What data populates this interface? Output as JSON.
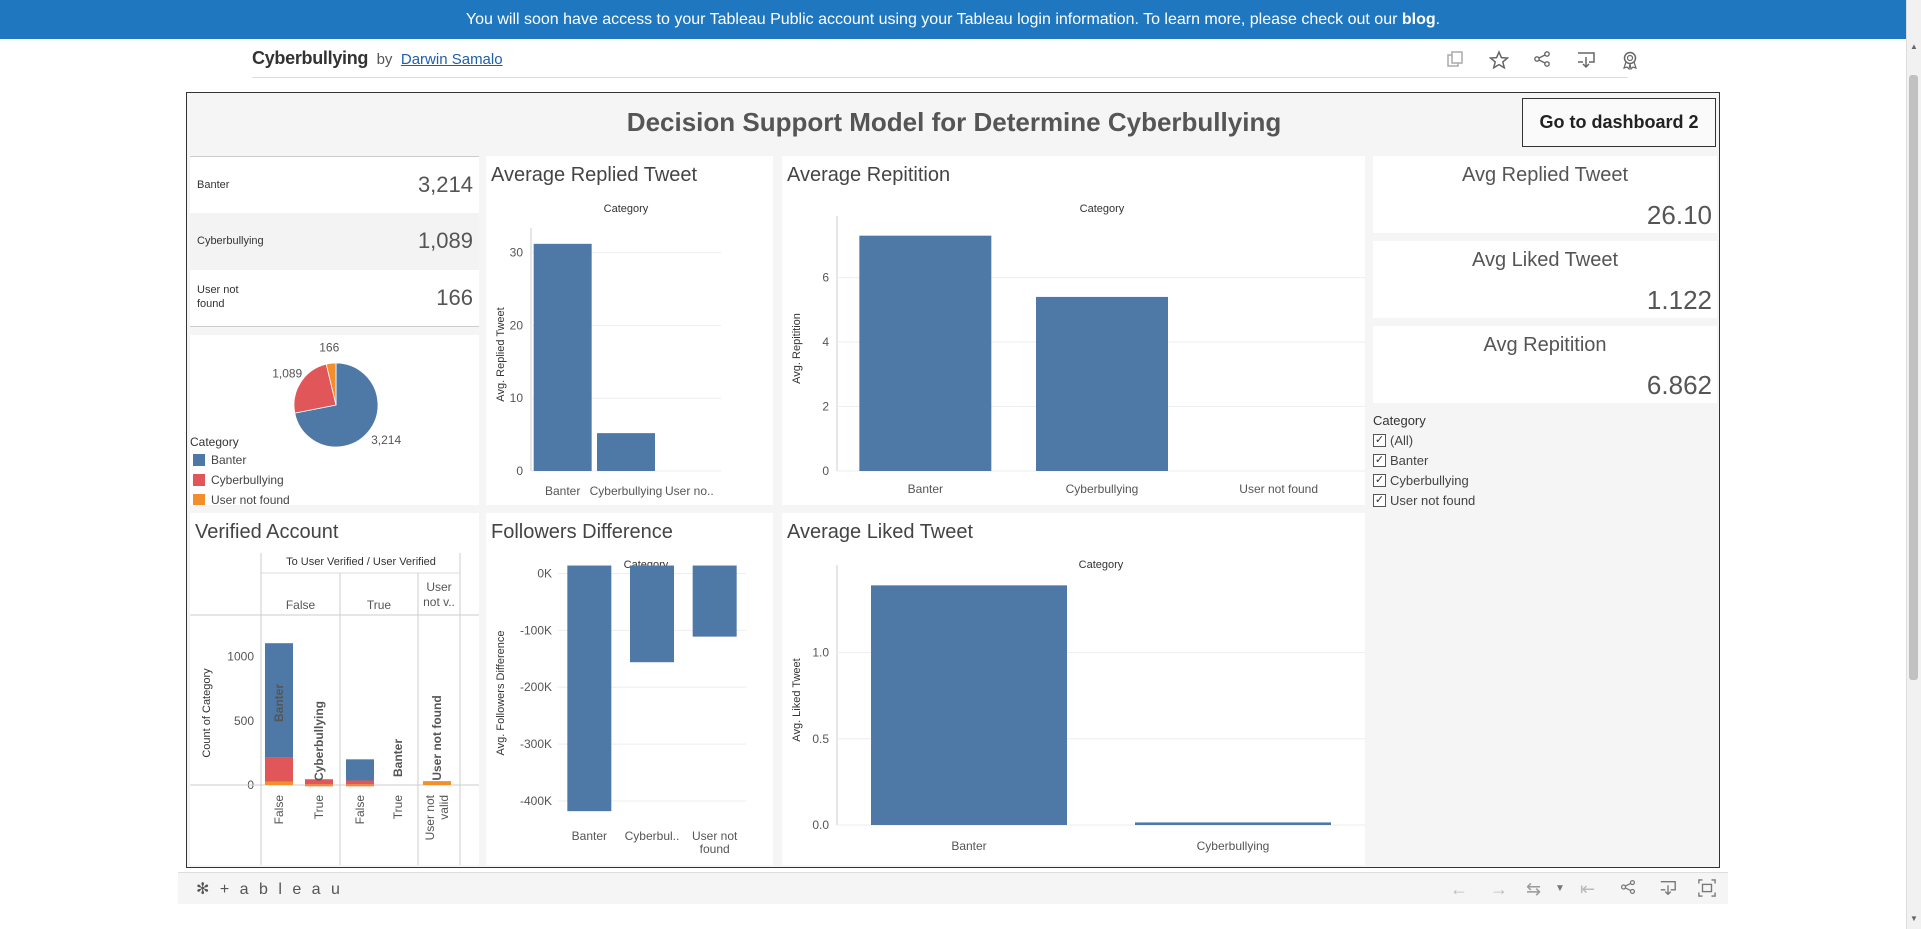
{
  "banner": {
    "text_before": "You will soon have access to your Tableau Public account using your Tableau login information. To learn more, please check out our ",
    "link": "blog",
    "text_after": "."
  },
  "header": {
    "title": "Cyberbullying",
    "by": "by",
    "author": "Darwin Samalo",
    "icons": [
      "copy-icon",
      "star-icon",
      "share-icon",
      "download-icon",
      "badge-icon"
    ]
  },
  "dashboard": {
    "title": "Decision Support Model for Determine Cyberbullying",
    "goto_button": "Go to dashboard 2"
  },
  "category_counts": [
    {
      "label": "Banter",
      "value": "3,214"
    },
    {
      "label": "Cyberbullying",
      "value": "1,089"
    },
    {
      "label": "User not found",
      "value": "166"
    }
  ],
  "pie": {
    "slices": [
      {
        "label": "3,214",
        "value": 3214,
        "color": "#4e79a7"
      },
      {
        "label": "1,089",
        "value": 1089,
        "color": "#e15759"
      },
      {
        "label": "166",
        "value": 166,
        "color": "#f28e2b"
      }
    ],
    "legend_title": "Category",
    "legend": [
      {
        "label": "Banter",
        "color": "#4e79a7"
      },
      {
        "label": "Cyberbullying",
        "color": "#e15759"
      },
      {
        "label": "User not found",
        "color": "#f28e2b"
      }
    ]
  },
  "avg_replied": {
    "title": "Average Replied Tweet",
    "header": "Category",
    "ylabel": "Avg. Replied Tweet",
    "ticks": [
      "0",
      "10",
      "20",
      "30"
    ],
    "categories": [
      "Banter",
      "Cyberbullying",
      "User no.."
    ]
  },
  "avg_repitition": {
    "title": "Average Repitition",
    "header": "Category",
    "ylabel": "Avg. Repitition",
    "ticks": [
      "0",
      "2",
      "4",
      "6"
    ],
    "categories": [
      "Banter",
      "Cyberbullying",
      "User not found"
    ]
  },
  "kpis": [
    {
      "title": "Avg Replied Tweet",
      "value": "26.10"
    },
    {
      "title": "Avg Liked Tweet",
      "value": "1.122"
    },
    {
      "title": "Avg Repitition",
      "value": "6.862"
    }
  ],
  "filter": {
    "title": "Category",
    "items": [
      "(All)",
      "Banter",
      "Cyberbullying",
      "User not found"
    ],
    "check": "✓"
  },
  "verified": {
    "title": "Verified Account",
    "header": "To User Verified / User Verified",
    "groups": [
      "False",
      "True",
      "User not v.."
    ],
    "ylabel": "Count of Category",
    "ticks": [
      "0",
      "500",
      "1000"
    ],
    "bar_labels": [
      "Banter",
      "Cyberbullying",
      "Banter",
      "User not found"
    ],
    "sub_labels": [
      "False",
      "True",
      "False",
      "True",
      "User not valid"
    ]
  },
  "followers": {
    "title": "Followers Difference",
    "header": "Category",
    "ylabel": "Avg. Followers Difference",
    "ticks": [
      "0K",
      "-100K",
      "-200K",
      "-300K",
      "-400K"
    ],
    "categories": [
      "Banter",
      "Cyberbul..",
      "User not found"
    ]
  },
  "avg_liked": {
    "title": "Average Liked Tweet",
    "header": "Category",
    "ylabel": "Avg. Liked Tweet",
    "ticks": [
      "0.0",
      "0.5",
      "1.0"
    ],
    "categories": [
      "Banter",
      "Cyberbullying"
    ]
  },
  "footer": {
    "logo": "+ a b l e a u",
    "logo_mark": "✻"
  },
  "chart_data": [
    {
      "type": "pie",
      "categories": [
        "Banter",
        "Cyberbullying",
        "User not found"
      ],
      "values": [
        3214,
        1089,
        166
      ]
    },
    {
      "type": "bar",
      "title": "Average Replied Tweet",
      "categories": [
        "Banter",
        "Cyberbullying",
        "User not found"
      ],
      "values": [
        31.2,
        5.2,
        0
      ],
      "ylabel": "Avg. Replied Tweet",
      "ylim": [
        0,
        32
      ]
    },
    {
      "type": "bar",
      "title": "Average Repitition",
      "categories": [
        "Banter",
        "Cyberbullying",
        "User not found"
      ],
      "values": [
        7.3,
        5.4,
        0
      ],
      "ylabel": "Avg. Repitition",
      "ylim": [
        0,
        7.6
      ]
    },
    {
      "type": "bar",
      "title": "Verified Account",
      "categories": [
        "False/False",
        "False/True",
        "True/False",
        "True/True",
        "User not valid"
      ],
      "series": [
        {
          "name": "Banter",
          "values": [
            890,
            0,
            165,
            0,
            0
          ]
        },
        {
          "name": "Cyberbullying",
          "values": [
            190,
            40,
            30,
            0,
            0
          ]
        },
        {
          "name": "User not found",
          "values": [
            25,
            5,
            5,
            0,
            30
          ]
        }
      ],
      "ylabel": "Count of Category",
      "ylim": [
        0,
        1200
      ]
    },
    {
      "type": "bar",
      "title": "Followers Difference",
      "categories": [
        "Banter",
        "Cyberbullying",
        "User not found"
      ],
      "values": [
        -418000,
        -156000,
        -111000
      ],
      "ylabel": "Avg. Followers Difference",
      "ylim": [
        -430000,
        15000
      ]
    },
    {
      "type": "bar",
      "title": "Average Liked Tweet",
      "categories": [
        "Banter",
        "Cyberbullying"
      ],
      "values": [
        1.39,
        0.015
      ],
      "ylabel": "Avg. Liked Tweet",
      "ylim": [
        0,
        1.45
      ]
    }
  ]
}
